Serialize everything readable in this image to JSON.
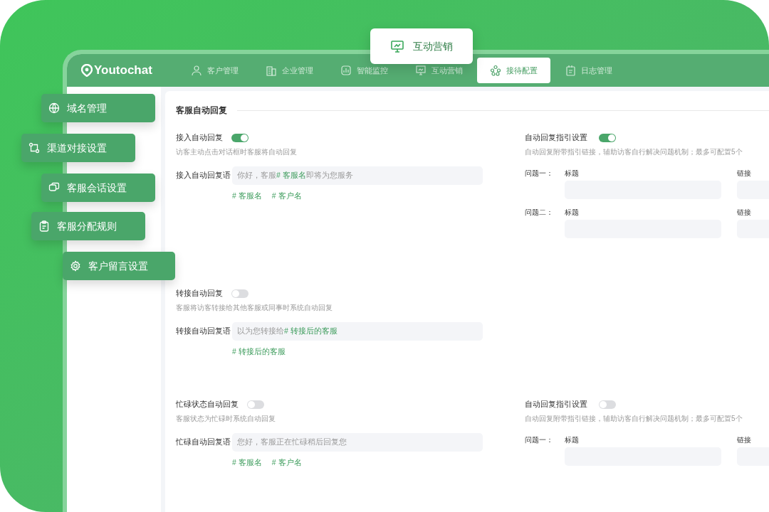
{
  "floating_tab": {
    "label": "互动营销"
  },
  "logo": "Youtochat",
  "nav": [
    {
      "label": "客户管理",
      "selected": false
    },
    {
      "label": "企业管理",
      "selected": false
    },
    {
      "label": "智能监控",
      "selected": false
    },
    {
      "label": "互动营销",
      "selected": false
    },
    {
      "label": "接待配置",
      "selected": true
    },
    {
      "label": "日志管理",
      "selected": false
    }
  ],
  "side_tags": [
    {
      "label": "域名管理"
    },
    {
      "label": "渠道对接设置"
    },
    {
      "label": "客服会话设置"
    },
    {
      "label": "客服分配规则"
    },
    {
      "label": "客户留言设置"
    }
  ],
  "section_title": "客服自动回复",
  "rows": [
    {
      "reply": {
        "title": "接入自动回复",
        "on": true,
        "description": "访客主动点击对话框时客服将自动回复",
        "field_label": "接入自动回复语",
        "value": [
          {
            "kind": "text",
            "text": "你好，客服"
          },
          {
            "kind": "variable",
            "text": "# 客服名"
          },
          {
            "kind": "text",
            "text": "即将为您服务"
          }
        ],
        "variables": [
          "# 客服名",
          "# 客户名"
        ]
      },
      "guide": {
        "title": "自动回复指引设置",
        "on": true,
        "description": "自动回复附带指引链接，辅助访客自行解决问题机制；最多可配置5个",
        "questions": [
          {
            "label": "问题一：",
            "title_label": "标题",
            "link_label": "链接"
          },
          {
            "label": "问题二：",
            "title_label": "标题",
            "link_label": "链接"
          }
        ]
      }
    },
    {
      "reply": {
        "title": "转接自动回复",
        "on": false,
        "description": "客服将访客转接给其他客服或同事时系统自动回复",
        "field_label": "转接自动回复语",
        "value": [
          {
            "kind": "text",
            "text": "以为您转接给"
          },
          {
            "kind": "variable",
            "text": "# 转接后的客服"
          }
        ],
        "variables": [
          "# 转接后的客服"
        ]
      }
    },
    {
      "reply": {
        "title": "忙碌状态自动回复",
        "on": false,
        "description": "客服状态为忙碌时系统自动回复",
        "field_label": "忙碌自动回复语",
        "value": [
          {
            "kind": "text",
            "text": "您好，客服正在忙碌稍后回复您"
          }
        ],
        "variables": [
          "# 客服名",
          "# 客户名"
        ]
      },
      "guide": {
        "title": "自动回复指引设置",
        "on": false,
        "description": "自动回复附带指引链接，辅助访客自行解决问题机制；最多可配置5个",
        "questions": [
          {
            "label": "问题一：",
            "title_label": "标题",
            "link_label": "链接"
          }
        ]
      }
    }
  ]
}
